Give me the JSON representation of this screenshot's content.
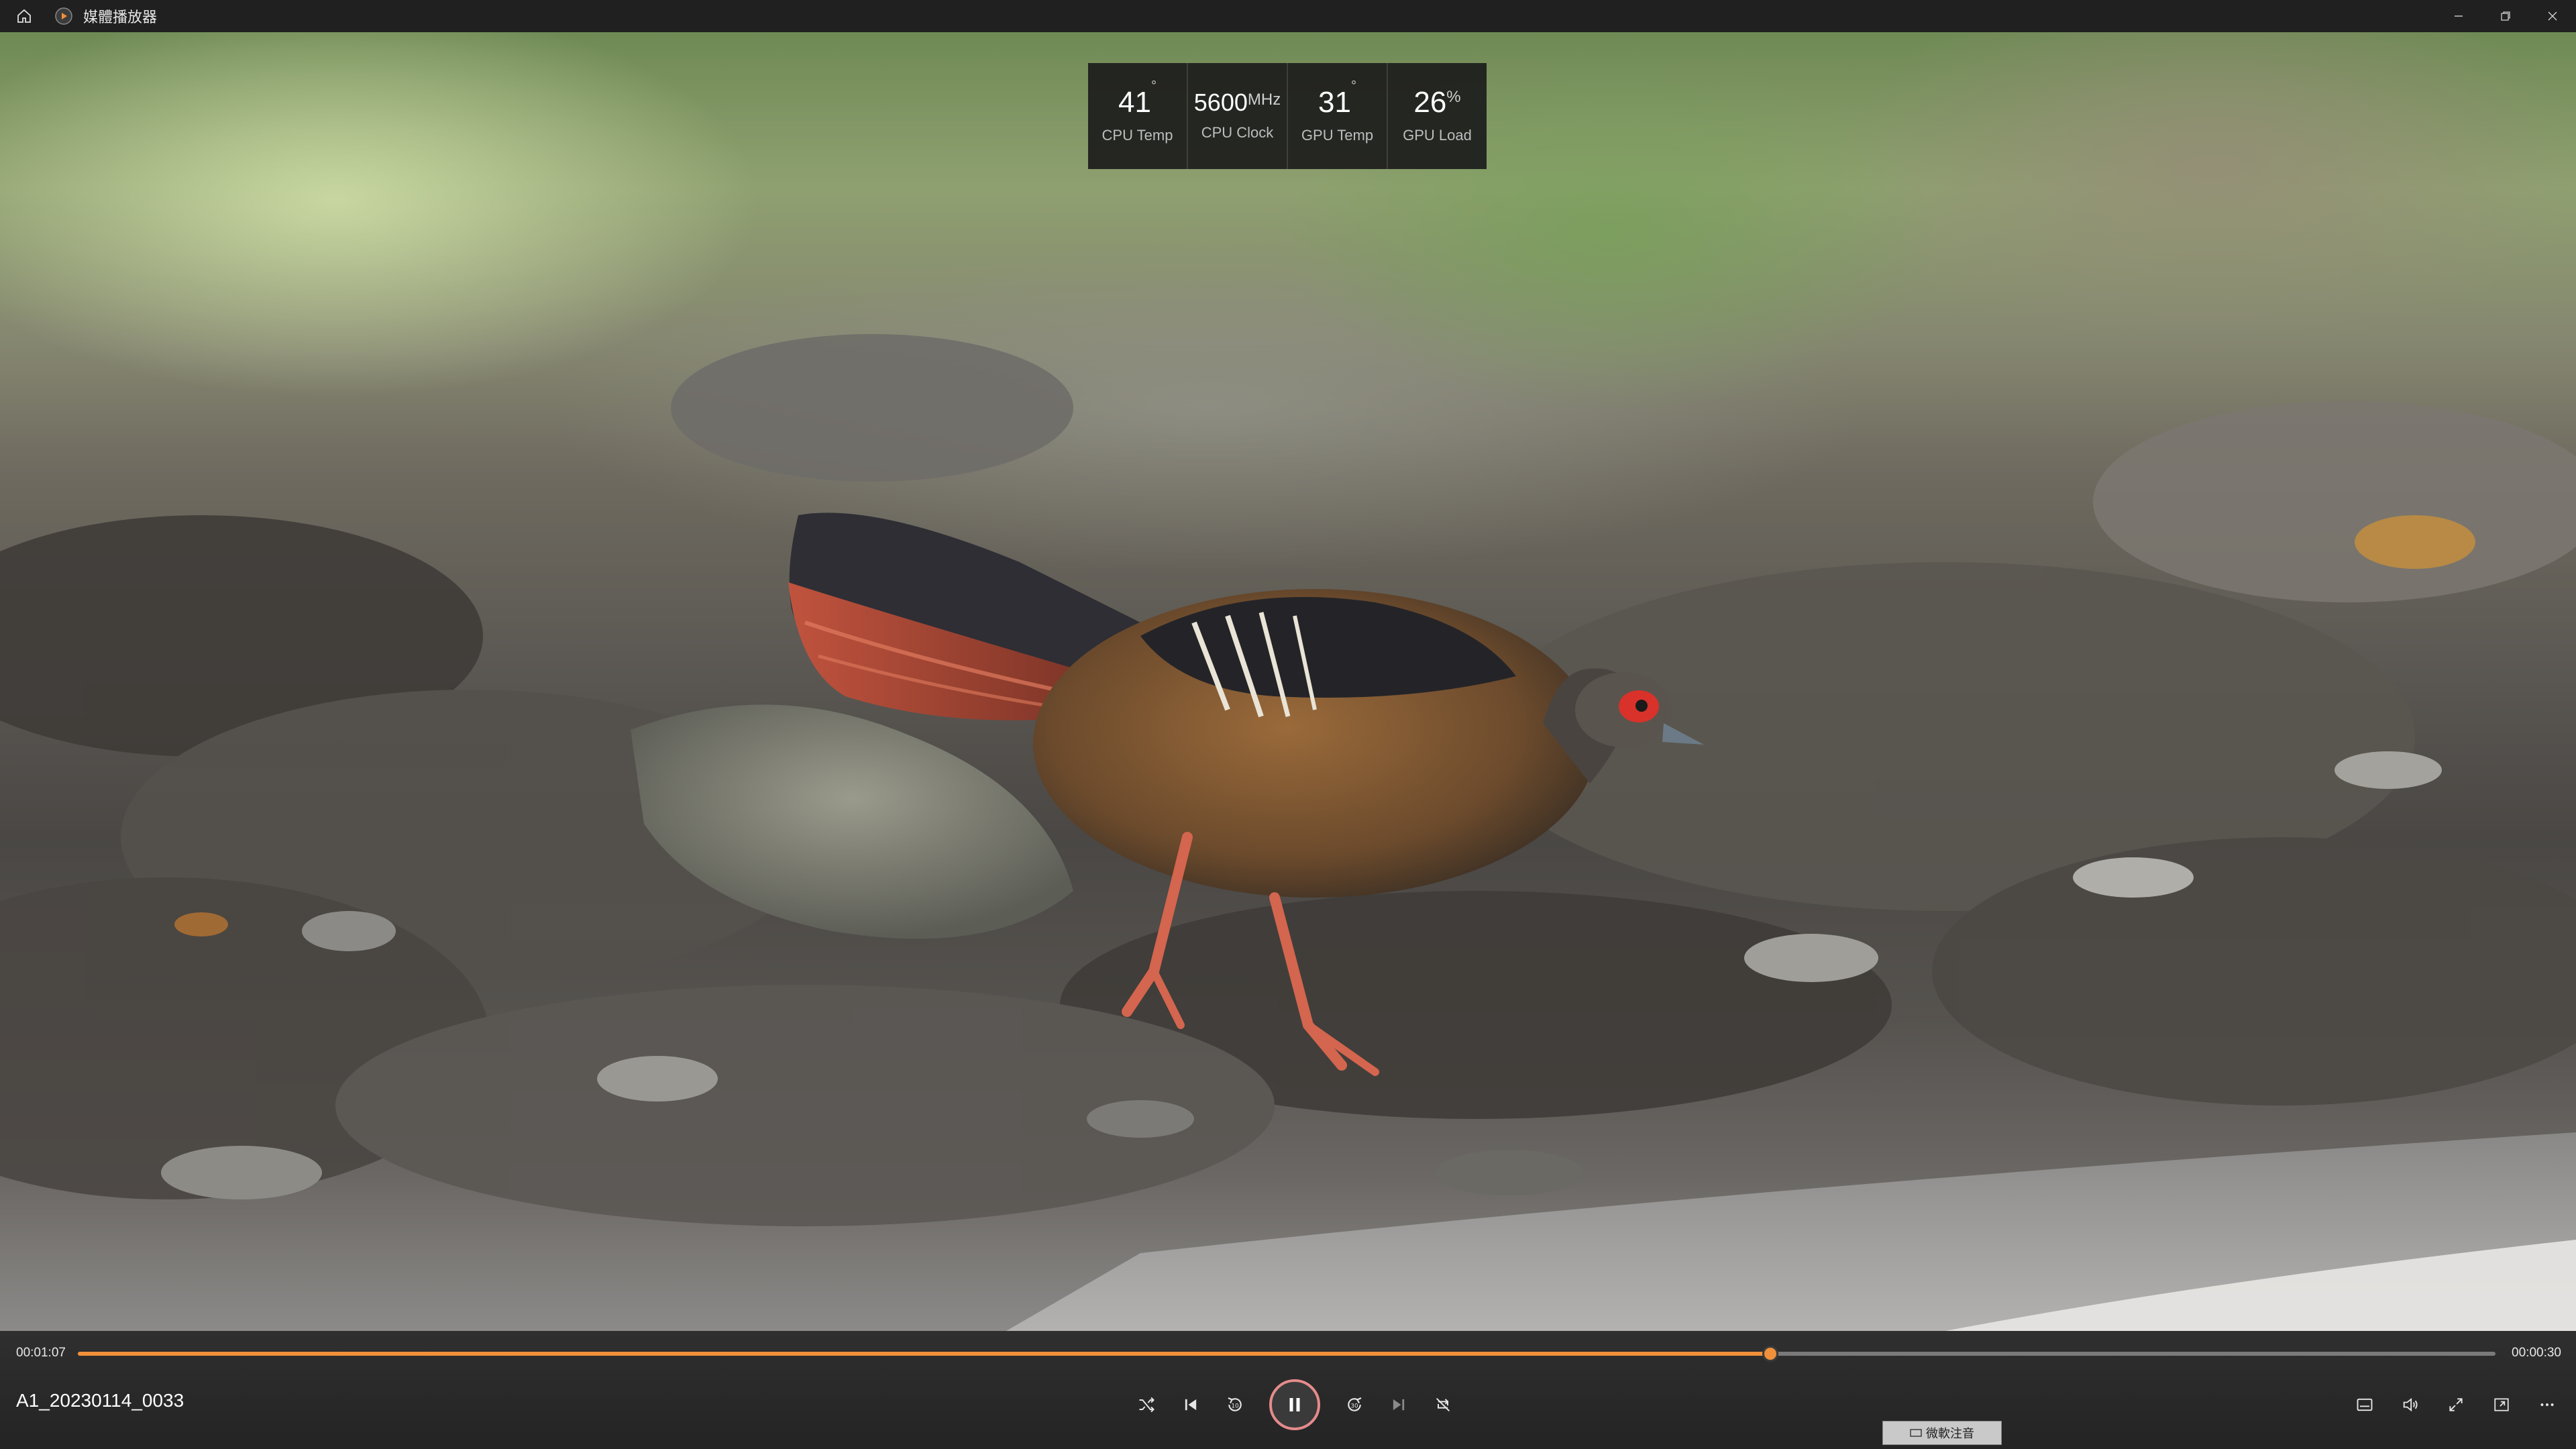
{
  "window": {
    "title": "媒體播放器",
    "app_icon": "media-player-icon",
    "home_icon": "home-icon"
  },
  "performance_overlay": {
    "items": [
      {
        "value": "41",
        "unit": "°",
        "label": "CPU Temp"
      },
      {
        "value": "5600",
        "unit": "MHz",
        "label": "CPU Clock"
      },
      {
        "value": "31",
        "unit": "°",
        "label": "GPU Temp"
      },
      {
        "value": "26",
        "unit": "%",
        "label": "GPU Load"
      }
    ]
  },
  "playback": {
    "current_time": "00:01:07",
    "total_time": "00:00:30",
    "progress": 0.7
  },
  "media": {
    "filename": "A1_20230114_0033"
  },
  "ime": {
    "label": "微軟注音"
  },
  "colors": {
    "accent": "#f0903a",
    "titlebar": "#202020",
    "controlbar": "#303030"
  }
}
